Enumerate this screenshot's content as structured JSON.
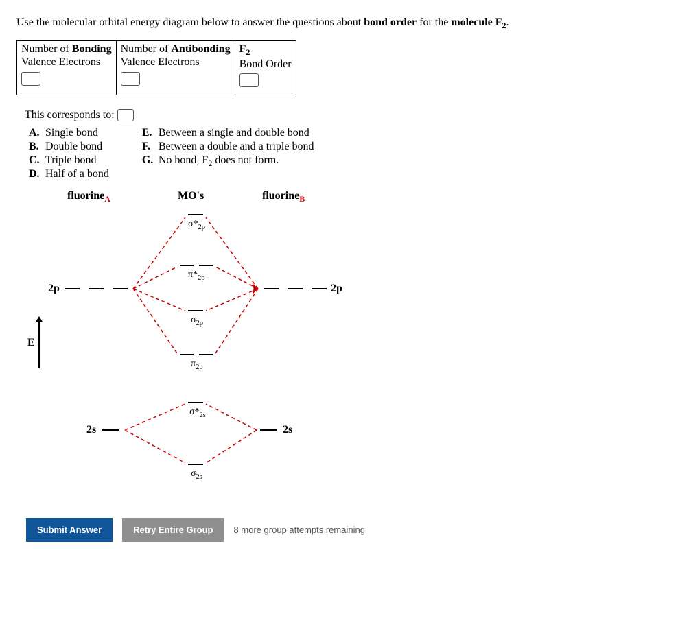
{
  "prompt": {
    "pre": "Use the molecular orbital energy diagram below to answer the questions about ",
    "bold1": "bond order",
    "mid": " for the ",
    "bold2": "molecule F",
    "sub": "2",
    "post": "."
  },
  "table": {
    "col1_line1": "Number of ",
    "col1_bold": "Bonding",
    "col1_line2": "Valence Electrons",
    "col2_line1": "Number of ",
    "col2_bold": "Antibonding",
    "col2_line2": "Valence Electrons",
    "col3_bold": "F",
    "col3_sub": "2",
    "col3_line2": "Bond Order"
  },
  "corresponds": "This corresponds to:",
  "choices_left": [
    {
      "letter": "A.",
      "text": "Single bond"
    },
    {
      "letter": "B.",
      "text": "Double bond"
    },
    {
      "letter": "C.",
      "text": "Triple bond"
    },
    {
      "letter": "D.",
      "text": "Half of a bond"
    }
  ],
  "choices_right": [
    {
      "letter": "E.",
      "text": "Between a single and double bond"
    },
    {
      "letter": "F.",
      "text": "Between a double and a triple bond"
    },
    {
      "letter": "G.",
      "text_pre": "No bond, F",
      "text_sub": "2",
      "text_post": " does not form."
    }
  ],
  "diagram": {
    "fluorineA": "fluorine",
    "subA": "A",
    "MOs": "MO's",
    "fluorineB": "fluorine",
    "subB": "B",
    "E": "E",
    "left_2p": "2p",
    "right_2p": "2p",
    "left_2s": "2s",
    "right_2s": "2s",
    "sigma_star_2p": "σ*",
    "sigma_star_2p_sub": "2p",
    "pi_star_2p": "π*",
    "pi_star_2p_sub": "2p",
    "sigma_2p": "σ",
    "sigma_2p_sub": "2p",
    "pi_2p": "π",
    "pi_2p_sub": "2p",
    "sigma_star_2s": "σ*",
    "sigma_star_2s_sub": "2s",
    "sigma_2s": "σ",
    "sigma_2s_sub": "2s"
  },
  "buttons": {
    "submit": "Submit Answer",
    "retry": "Retry Entire Group",
    "attempts": "8 more group attempts remaining"
  }
}
